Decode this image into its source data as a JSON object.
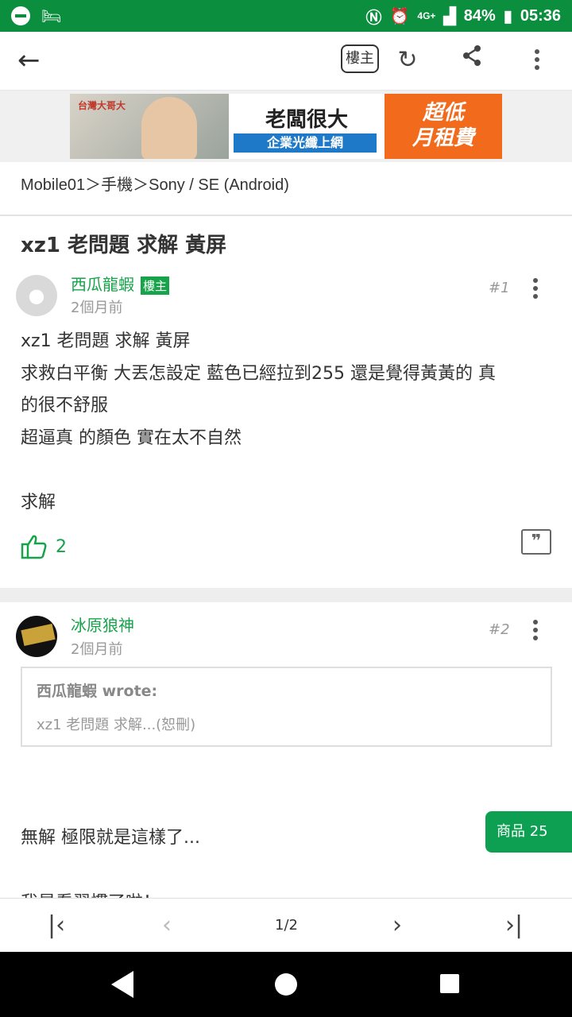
{
  "status_bar": {
    "network": "4G+",
    "battery": "84%",
    "time": "05:36"
  },
  "toolbar": {
    "back_icon": "back-arrow-icon",
    "op_filter_label": "樓主",
    "refresh_icon": "refresh-icon",
    "share_icon": "share-icon",
    "more_icon": "more-vert-icon"
  },
  "ad": {
    "brand": "台灣大哥大",
    "headline": "老闆很大",
    "subline": "企業光纖上網",
    "offer_line1": "超低",
    "offer_line2": "月租費"
  },
  "breadcrumb": "Mobile01＞手機＞Sony / SE (Android)",
  "thread": {
    "title": "xz1 老問題 求解 黃屏"
  },
  "posts": [
    {
      "author": "西瓜龍蝦",
      "op_tag": "樓主",
      "time": "2個月前",
      "number": "#1",
      "body_lines": [
        "xz1 老問題 求解 黃屏",
        "求救白平衡 大丟怎設定 藍色已經拉到255 還是覺得黃黃的 真",
        "的很不舒服",
        "超逼真 的顏色 實在太不自然",
        "",
        "求解"
      ],
      "likes": "2"
    },
    {
      "author": "冰原狼神",
      "time": "2個月前",
      "number": "#2",
      "quote_author": "西瓜龍蝦 wrote:",
      "quote_text": "xz1 老問題 求解...(恕刪)",
      "body_line1": "無解 極限就是這樣了...",
      "body_line2": "我是看習慣了啦！"
    }
  ],
  "product_button": "商品 25",
  "pager": {
    "first_icon": "first-page-icon",
    "prev_icon": "prev-page-icon",
    "page": "1/2",
    "next_icon": "next-page-icon",
    "last_icon": "last-page-icon"
  }
}
